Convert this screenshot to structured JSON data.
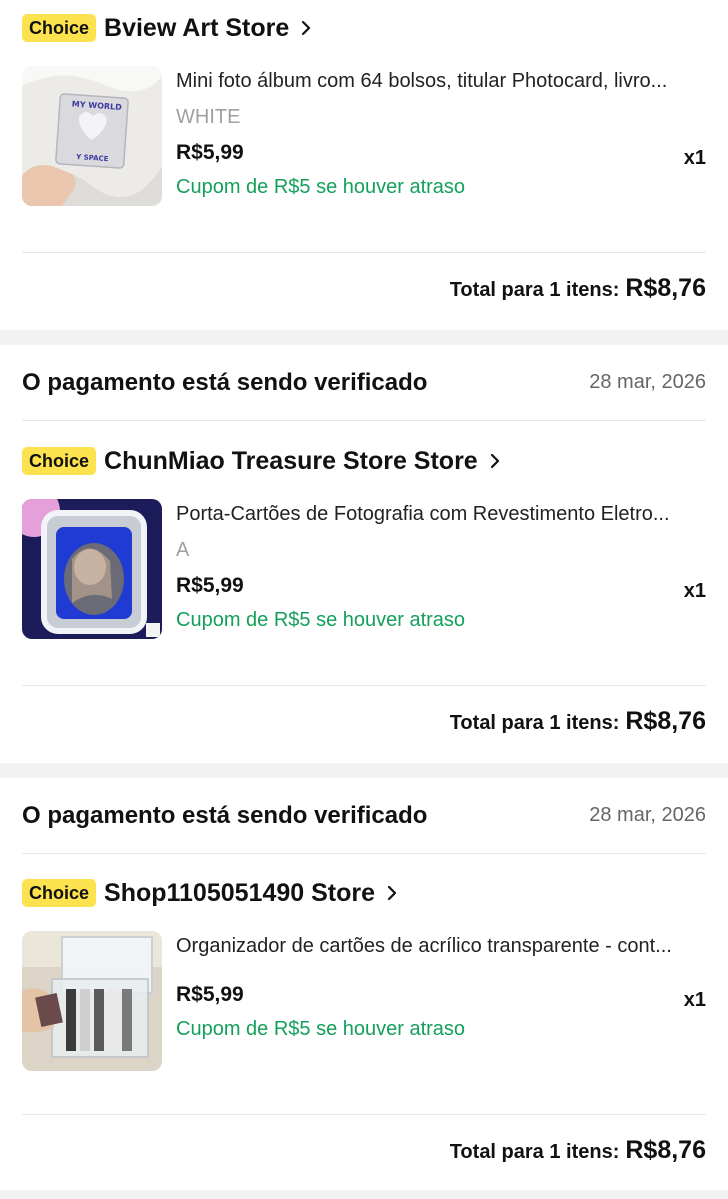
{
  "orders": [
    {
      "status": "",
      "date": "",
      "badge": "Choice",
      "store": "Bview Art Store",
      "product": {
        "title": "Mini foto álbum com 64 bolsos, titular Photocard, livro...",
        "variant": "WHITE",
        "price": "R$5,99",
        "coupon": "Cupom de R$5 se houver atraso",
        "qty": "x1",
        "thumb_text_1": "MY WORLD",
        "thumb_text_2": "Y SPACE"
      },
      "total_label": "Total para 1 itens:",
      "total_amount": "R$8,76"
    },
    {
      "status": "O pagamento está sendo verificado",
      "date": "28 mar, 2026",
      "badge": "Choice",
      "store": "ChunMiao Treasure Store Store",
      "product": {
        "title": "Porta-Cartões de Fotografia com Revestimento Eletro...",
        "variant": "A",
        "price": "R$5,99",
        "coupon": "Cupom de R$5 se houver atraso",
        "qty": "x1"
      },
      "total_label": "Total para 1 itens:",
      "total_amount": "R$8,76"
    },
    {
      "status": "O pagamento está sendo verificado",
      "date": "28 mar, 2026",
      "badge": "Choice",
      "store": "Shop1105051490 Store",
      "product": {
        "title": "Organizador de cartões de acrílico transparente - cont...",
        "variant": "",
        "price": "R$5,99",
        "coupon": "Cupom de R$5 se houver atraso",
        "qty": "x1"
      },
      "total_label": "Total para 1 itens:",
      "total_amount": "R$8,76"
    }
  ],
  "colors": {
    "choice_badge": "#fde24f",
    "coupon_green": "#14a05a",
    "page_background": "#f2f2f2"
  }
}
